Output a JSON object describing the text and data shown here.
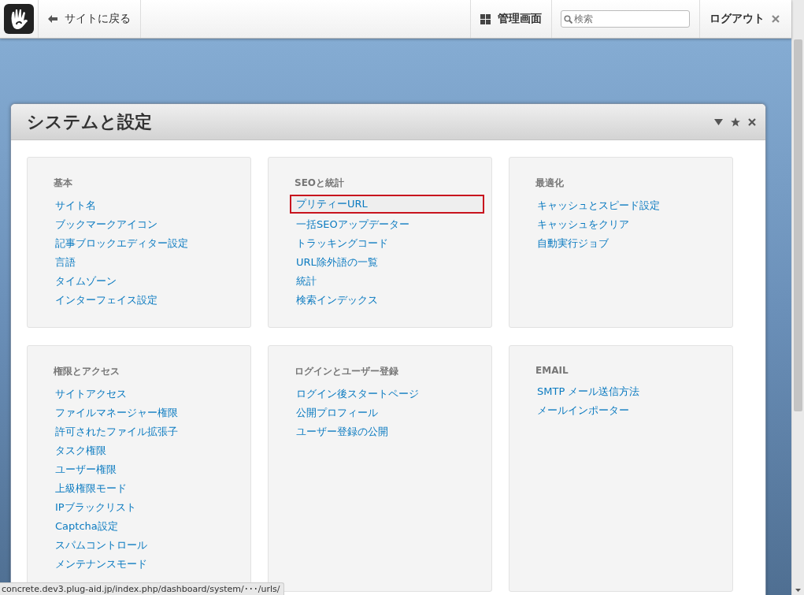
{
  "toolbar": {
    "back_link": "サイトに戻る",
    "dashboard_link": "管理画面",
    "search": {
      "placeholder": "検索"
    },
    "logout": "ログアウト"
  },
  "panel": {
    "title": "システムと設定",
    "sections": [
      {
        "title": "基本",
        "links": [
          {
            "label": "サイト名",
            "highlighted": false
          },
          {
            "label": "ブックマークアイコン",
            "highlighted": false
          },
          {
            "label": "記事ブロックエディター設定",
            "highlighted": false
          },
          {
            "label": "言語",
            "highlighted": false
          },
          {
            "label": "タイムゾーン",
            "highlighted": false
          },
          {
            "label": "インターフェイス設定",
            "highlighted": false
          }
        ]
      },
      {
        "title": "SEOと統計",
        "links": [
          {
            "label": "プリティーURL",
            "highlighted": true
          },
          {
            "label": "一括SEOアップデーター",
            "highlighted": false
          },
          {
            "label": "トラッキングコード",
            "highlighted": false
          },
          {
            "label": "URL除外語の一覧",
            "highlighted": false
          },
          {
            "label": "統計",
            "highlighted": false
          },
          {
            "label": "検索インデックス",
            "highlighted": false
          }
        ]
      },
      {
        "title": "最適化",
        "links": [
          {
            "label": "キャッシュとスピード設定",
            "highlighted": false
          },
          {
            "label": "キャッシュをクリア",
            "highlighted": false
          },
          {
            "label": "自動実行ジョブ",
            "highlighted": false
          }
        ]
      },
      {
        "title": "権限とアクセス",
        "links": [
          {
            "label": "サイトアクセス",
            "highlighted": false
          },
          {
            "label": "ファイルマネージャー権限",
            "highlighted": false
          },
          {
            "label": "許可されたファイル拡張子",
            "highlighted": false
          },
          {
            "label": "タスク権限",
            "highlighted": false
          },
          {
            "label": "ユーザー権限",
            "highlighted": false
          },
          {
            "label": "上級権限モード",
            "highlighted": false
          },
          {
            "label": "IPブラックリスト",
            "highlighted": false
          },
          {
            "label": "Captcha設定",
            "highlighted": false
          },
          {
            "label": "スパムコントロール",
            "highlighted": false
          },
          {
            "label": "メンテナンスモード",
            "highlighted": false
          }
        ]
      },
      {
        "title": "ログインとユーザー登録",
        "links": [
          {
            "label": "ログイン後スタートページ",
            "highlighted": false
          },
          {
            "label": "公開プロフィール",
            "highlighted": false
          },
          {
            "label": "ユーザー登録の公開",
            "highlighted": false
          }
        ]
      },
      {
        "title": "EMAIL",
        "links": [
          {
            "label": "SMTP メール送信方法",
            "highlighted": false
          },
          {
            "label": "メールインポーター",
            "highlighted": false
          }
        ]
      }
    ]
  },
  "status_bar": "concrete.dev3.plug-aid.jp/index.php/dashboard/system/･･･/urls/"
}
